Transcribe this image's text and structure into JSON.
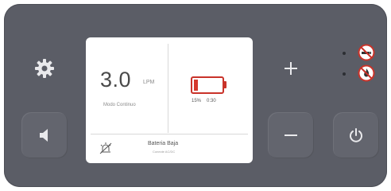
{
  "display": {
    "flow": {
      "value": "3.0",
      "unit": "LPM",
      "mode": "Modo Continuo"
    },
    "battery": {
      "level": 0.15,
      "percent": "15%",
      "time": "0:30"
    },
    "alert": {
      "title": "Bateria Baja",
      "subtitle": "Conecte AC/DC"
    }
  },
  "icons": {
    "settings": "gear-icon",
    "sound": "speaker-icon",
    "plus": "plus-icon",
    "minus": "minus-icon",
    "power": "power-icon",
    "alarm": "muted-alarm-icon",
    "badges": [
      "no-smoking-icon",
      "no-flame-icon"
    ]
  },
  "colors": {
    "device_body": "#5b5d66",
    "button": "#63656e",
    "screen": "#ffffff",
    "battery_low": "#d5382c",
    "warning_badge": "#c9332a"
  }
}
